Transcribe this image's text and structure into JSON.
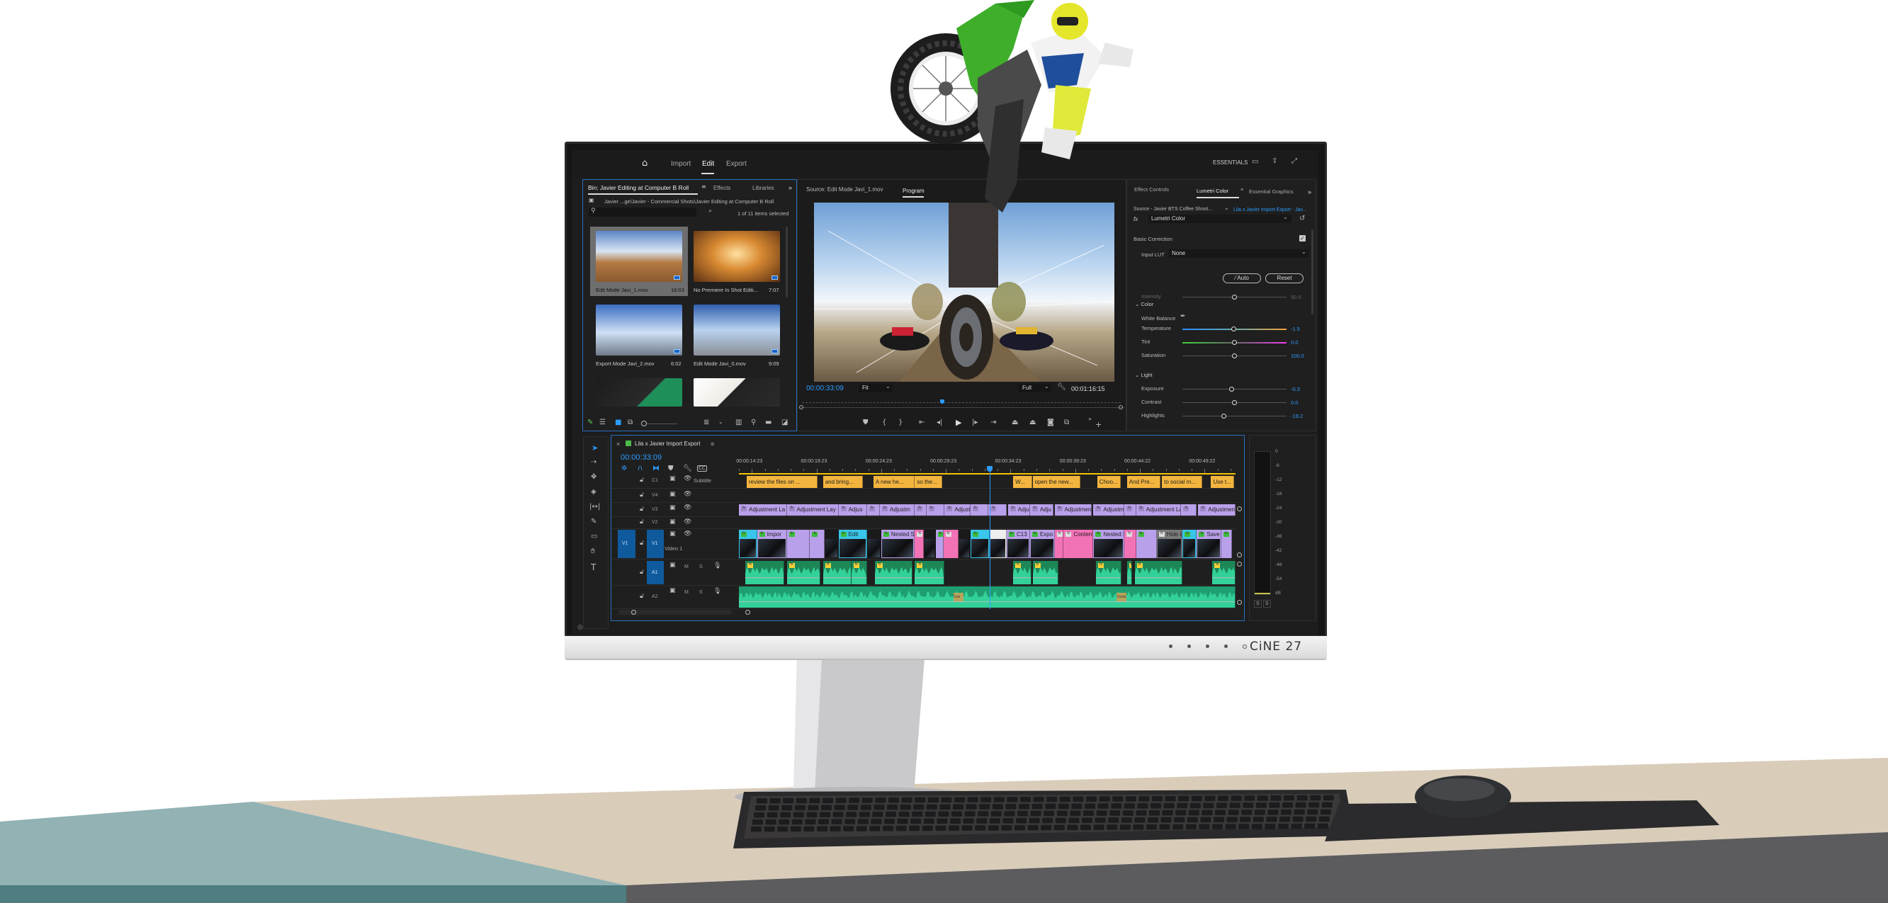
{
  "app": {
    "nav": {
      "home_icon": "home-icon",
      "import": "Import",
      "edit": "Edit",
      "export": "Export",
      "active": "Edit"
    },
    "workspace": "ESSENTIALS"
  },
  "project_panel": {
    "tabs": [
      "Bin: Javier Editing at Computer B Roll",
      "Effects",
      "Libraries"
    ],
    "overflow": "»",
    "path": "Javier ...ge\\Javier - Commercial Shots\\Javier Editing at Computer B Roll",
    "search_placeholder": "",
    "selection_status": "1 of 11 items selected",
    "items": [
      {
        "name": "Edit Mode Javi_1.mov",
        "duration": "16:03",
        "selected": true
      },
      {
        "name": "No Premiere In Shot Editi...",
        "duration": "7:07",
        "selected": false
      },
      {
        "name": "Export Mode Javi_2.mov",
        "duration": "6:02",
        "selected": false
      },
      {
        "name": "Edit Mode Javi_0.mov",
        "duration": "9:09",
        "selected": false
      },
      {
        "name": "",
        "duration": "",
        "selected": false
      },
      {
        "name": "",
        "duration": "",
        "selected": false
      }
    ]
  },
  "monitor": {
    "source_tab": "Source: Edit Mode Javi_1.mov",
    "program_tab": "Program",
    "current_time": "00:00:33:09",
    "zoom": "Fit",
    "resolution": "Full",
    "duration": "00:01:16:15",
    "playhead_fraction": 0.44
  },
  "lumetri": {
    "tabs": [
      "Effect Controls",
      "Lumetri Color",
      "Essential Graphics"
    ],
    "overflow": "»",
    "source": "Source - Javier BTS Coffee Shoot...",
    "sequence_link": "Lila x Javier Import Export - Jav...",
    "fx_label": "fx",
    "effect": "Lumetri Color",
    "basic_correction": "Basic Correction",
    "basic_enabled": true,
    "input_lut_label": "Input LUT",
    "input_lut_value": "None",
    "auto": "Auto",
    "reset": "Reset",
    "color_section": "Color",
    "white_balance": "White Balance",
    "light_section": "Light",
    "sliders": [
      {
        "label": "Intensity",
        "value": "50.0",
        "level": 0.5,
        "style": "plain",
        "disabled": true
      },
      {
        "label": "Temperature",
        "value": "-1.5",
        "level": 0.49,
        "style": "temperature"
      },
      {
        "label": "Tint",
        "value": "0.0",
        "level": 0.5,
        "style": "tint"
      },
      {
        "label": "Saturation",
        "value": "100.0",
        "level": 0.5,
        "style": "plain"
      },
      {
        "label": "Exposure",
        "value": "-0.3",
        "level": 0.47,
        "style": "plain"
      },
      {
        "label": "Contrast",
        "value": "0.0",
        "level": 0.5,
        "style": "plain"
      },
      {
        "label": "Highlights",
        "value": "-19.2",
        "level": 0.4,
        "style": "plain"
      }
    ]
  },
  "timeline": {
    "sequence": "Lila x Javier Import Export",
    "timecode": "00:00:33:09",
    "playhead_seconds": 33.4,
    "ruler": [
      {
        "t": 15,
        "label": "00:00:14:23"
      },
      {
        "t": 20,
        "label": "00:00:19:23"
      },
      {
        "t": 25,
        "label": "00:00:24:23"
      },
      {
        "t": 30,
        "label": "00:00:29:23"
      },
      {
        "t": 35,
        "label": "00:00:34:23"
      },
      {
        "t": 40,
        "label": "00:00:39:23"
      },
      {
        "t": 45,
        "label": "00:00:44:22"
      },
      {
        "t": 50,
        "label": "00:00:49:22"
      }
    ],
    "tracks": {
      "C1": {
        "name": "C1",
        "label": "Subtitle"
      },
      "V4": {
        "name": "V4"
      },
      "V3": {
        "name": "V3"
      },
      "V2": {
        "name": "V2"
      },
      "V1": {
        "name": "V1",
        "source": "V1",
        "label": "Video 1"
      },
      "A1": {
        "name": "A1",
        "m": "M",
        "s": "S"
      },
      "A2": {
        "name": "A2",
        "m": "M",
        "s": "S"
      }
    },
    "subtitle_clips": [
      {
        "start": 14.6,
        "end": 20.1,
        "text": "review the files on ..."
      },
      {
        "start": 20.5,
        "end": 23.6,
        "text": "and bring..."
      },
      {
        "start": 24.4,
        "end": 27.6,
        "text": "A new he..."
      },
      {
        "start": 27.6,
        "end": 29.7,
        "text": "so the..."
      },
      {
        "start": 35.2,
        "end": 36.7,
        "text": "W..."
      },
      {
        "start": 36.7,
        "end": 40.4,
        "text": "open the new..."
      },
      {
        "start": 41.7,
        "end": 43.5,
        "text": "Choo..."
      },
      {
        "start": 44.0,
        "end": 46.6,
        "text": "And Pre..."
      },
      {
        "start": 46.7,
        "end": 49.8,
        "text": "to social m..."
      },
      {
        "start": 50.5,
        "end": 52.3,
        "text": "Use t..."
      }
    ],
    "v3_clips": [
      {
        "start": 14.0,
        "end": 17.7,
        "text": "Adjustment La"
      },
      {
        "start": 17.7,
        "end": 21.7,
        "text": "Adjustment Lay"
      },
      {
        "start": 21.7,
        "end": 23.9,
        "text": "Adjus"
      },
      {
        "start": 23.9,
        "end": 24.9,
        "text": ""
      },
      {
        "start": 24.9,
        "end": 27.6,
        "text": "Adjustm"
      },
      {
        "start": 27.6,
        "end": 28.5,
        "text": ""
      },
      {
        "start": 28.5,
        "end": 29.9,
        "text": ""
      },
      {
        "start": 29.9,
        "end": 31.9,
        "text": "Adjust"
      },
      {
        "start": 31.9,
        "end": 33.3,
        "text": ""
      },
      {
        "start": 33.3,
        "end": 34.7,
        "text": ""
      },
      {
        "start": 34.8,
        "end": 36.5,
        "text": "Adju"
      },
      {
        "start": 36.5,
        "end": 38.3,
        "text": "Adju"
      },
      {
        "start": 38.4,
        "end": 41.3,
        "text": "Adjustment L"
      },
      {
        "start": 41.4,
        "end": 43.8,
        "text": "Adjustme"
      },
      {
        "start": 43.8,
        "end": 44.7,
        "text": ""
      },
      {
        "start": 44.7,
        "end": 48.2,
        "text": "Adjustment Layer"
      },
      {
        "start": 48.2,
        "end": 49.4,
        "text": ""
      },
      {
        "start": 49.5,
        "end": 52.4,
        "text": "Adjustment L"
      }
    ],
    "v1_clips": [
      {
        "start": 14.0,
        "end": 15.4,
        "color": "cyan",
        "text": ""
      },
      {
        "start": 15.4,
        "end": 17.7,
        "color": "purple",
        "text": "Impor"
      },
      {
        "start": 17.7,
        "end": 19.5,
        "color": "purple",
        "text": ""
      },
      {
        "start": 19.5,
        "end": 20.6,
        "color": "purple",
        "text": ""
      },
      {
        "start": 20.6,
        "end": 21.7,
        "color": "dark",
        "text": ""
      },
      {
        "start": 21.7,
        "end": 23.9,
        "color": "cyan",
        "text": "Edit"
      },
      {
        "start": 23.9,
        "end": 25.0,
        "color": "dark",
        "text": ""
      },
      {
        "start": 25.0,
        "end": 27.6,
        "color": "purple",
        "text": "Nested S"
      },
      {
        "start": 27.6,
        "end": 28.3,
        "color": "pink",
        "text": ""
      },
      {
        "start": 28.3,
        "end": 29.2,
        "color": "dark",
        "text": ""
      },
      {
        "start": 29.2,
        "end": 29.8,
        "color": "purple",
        "text": ""
      },
      {
        "start": 29.8,
        "end": 31.0,
        "color": "pink",
        "text": ""
      },
      {
        "start": 31.0,
        "end": 31.9,
        "color": "dark",
        "text": ""
      },
      {
        "start": 31.9,
        "end": 33.4,
        "color": "cyan",
        "text": ""
      },
      {
        "start": 33.4,
        "end": 34.7,
        "color": "white",
        "text": ""
      },
      {
        "start": 34.7,
        "end": 36.5,
        "color": "purple",
        "text": "C13"
      },
      {
        "start": 36.5,
        "end": 38.4,
        "color": "purple",
        "text": "Expo"
      },
      {
        "start": 38.4,
        "end": 39.1,
        "color": "pink",
        "text": ""
      },
      {
        "start": 39.1,
        "end": 41.4,
        "color": "pink",
        "text": "Content"
      },
      {
        "start": 41.4,
        "end": 43.8,
        "color": "purple",
        "text": "Nested S"
      },
      {
        "start": 43.8,
        "end": 44.7,
        "color": "pink",
        "text": ""
      },
      {
        "start": 44.7,
        "end": 46.3,
        "color": "purple",
        "text": ""
      },
      {
        "start": 46.3,
        "end": 48.3,
        "color": "gray",
        "text": "Hide L"
      },
      {
        "start": 48.3,
        "end": 49.4,
        "color": "cyan",
        "text": ""
      },
      {
        "start": 49.4,
        "end": 51.3,
        "color": "purple",
        "text": "Save"
      },
      {
        "start": 51.3,
        "end": 52.1,
        "color": "purple",
        "text": ""
      }
    ],
    "a1_clips": [
      {
        "start": 14.5,
        "end": 17.5
      },
      {
        "start": 17.7,
        "end": 20.3
      },
      {
        "start": 20.5,
        "end": 22.7
      },
      {
        "start": 22.7,
        "end": 23.9
      },
      {
        "start": 24.5,
        "end": 27.4
      },
      {
        "start": 27.6,
        "end": 29.9
      },
      {
        "start": 35.2,
        "end": 36.6
      },
      {
        "start": 36.7,
        "end": 38.7
      },
      {
        "start": 41.6,
        "end": 43.6
      },
      {
        "start": 44.0,
        "end": 44.4
      },
      {
        "start": 44.6,
        "end": 48.3
      },
      {
        "start": 50.6,
        "end": 52.4
      }
    ],
    "a2_clips": [
      {
        "start": 14.0,
        "end": 52.4
      }
    ],
    "a2_transitions": [
      "Con",
      "Const"
    ]
  },
  "audio_meter": {
    "scale": [
      "0",
      "-6",
      "-12",
      "-18",
      "-24",
      "-30",
      "-36",
      "-42",
      "-48",
      "-54",
      "dB"
    ],
    "solo_buttons": [
      "S",
      "S"
    ]
  },
  "device": {
    "brand": "CiNE 27"
  },
  "colors": {
    "accent": "#2d9cff",
    "subtitle": "#f4b53f",
    "adjustment": "#b9a0ea",
    "pink": "#f272b6",
    "cyan": "#39c6ea",
    "audio": "#33d19a",
    "audio_dark": "#1e8758",
    "track_blue": "#0f5a9c"
  }
}
